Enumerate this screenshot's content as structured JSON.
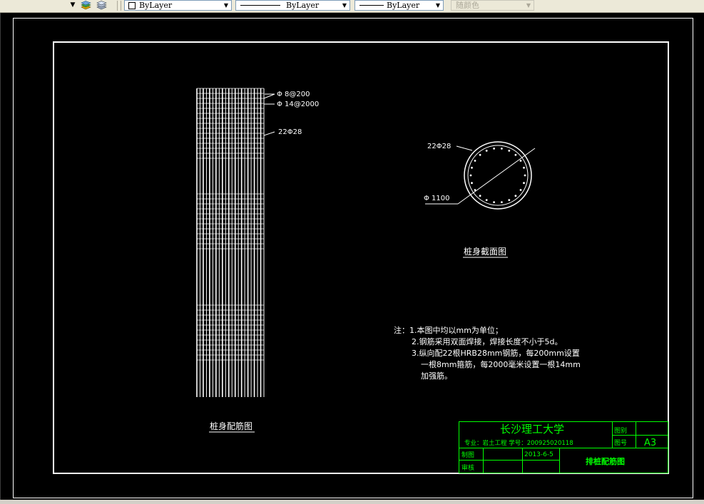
{
  "toolbar": {
    "color_combo": "ByLayer",
    "linetype_combo": "ByLayer",
    "lineweight_combo": "ByLayer",
    "plotstyle_combo": "随颜色"
  },
  "drawing": {
    "elevation_title": "桩身配筋图",
    "section_title": "桩身截面图",
    "leader_stirrup": "Φ 8@200",
    "leader_ring": "Φ 14@2000",
    "leader_main_elev": "22Φ28",
    "leader_main_section": "22Φ28",
    "leader_diameter": "Φ 1100",
    "notes": [
      "注：1.本图中均以mm为单位；",
      "2.钢筋采用双面焊接，焊接长度不小于5d。",
      "3.纵向配22根HRB28mm钢筋，每200mm设置",
      "一根8mm箍筋，每2000毫米设置一根14mm",
      "加强筋。"
    ]
  },
  "title_block": {
    "school": "长沙理工大学",
    "major_line": "专业：岩土工程   学号：200925020118",
    "label_category": "图别",
    "label_number": "图号",
    "value_number": "A3",
    "label_drawn": "制图",
    "label_checked": "审核",
    "date": "2013-6-5",
    "drawing_name": "排桩配筋图"
  },
  "colors": {
    "canvas": "#000000",
    "lines": "#ffffff",
    "title_block": "#00ff00"
  }
}
